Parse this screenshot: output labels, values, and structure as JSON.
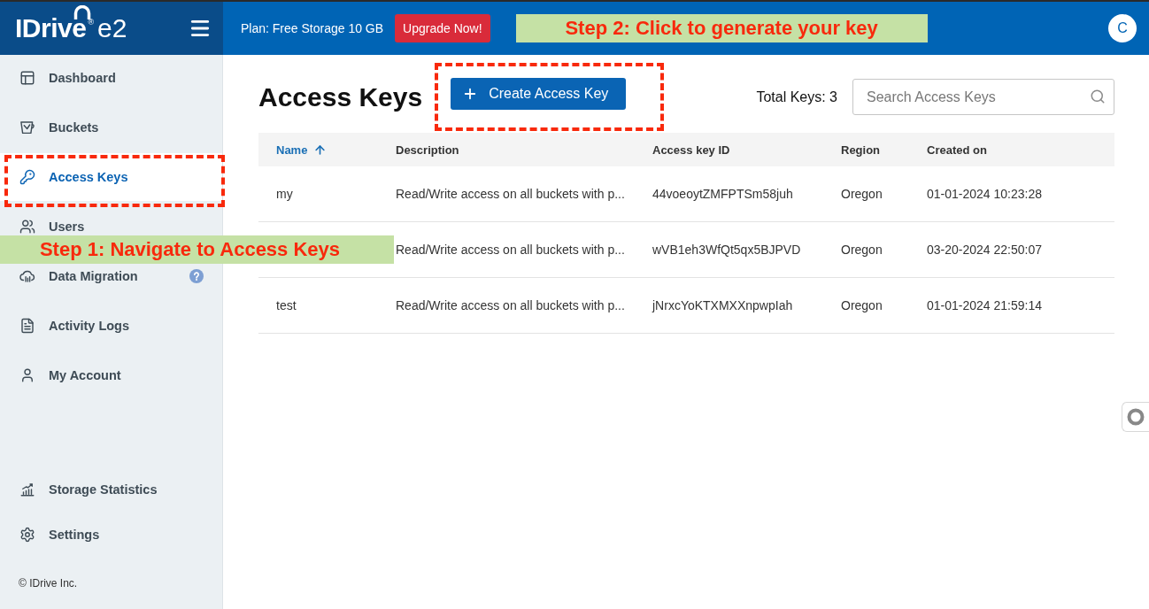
{
  "top_bar": {
    "logo": {
      "brand": "IDrive",
      "mark": "®",
      "product": "e2"
    },
    "plan": "Plan: Free Storage 10 GB",
    "upgrade_button": "Upgrade Now!",
    "callout": "Step 2: Click to generate your key",
    "avatar": "C"
  },
  "sidebar": {
    "items": [
      {
        "label": "Dashboard",
        "selected": false,
        "outlined": false,
        "help": false
      },
      {
        "label": "Buckets",
        "selected": false,
        "outlined": false,
        "help": false
      },
      {
        "label": "Access Keys",
        "selected": true,
        "outlined": true,
        "help": false
      },
      {
        "label": "Users",
        "selected": false,
        "outlined": false,
        "help": false
      },
      {
        "label": "Data Migration",
        "selected": false,
        "outlined": false,
        "help": true
      },
      {
        "label": "Activity Logs",
        "selected": false,
        "outlined": false,
        "help": false
      },
      {
        "label": "My Account",
        "selected": false,
        "outlined": false,
        "help": false
      }
    ],
    "bottom_items": [
      {
        "label": "Storage Statistics",
        "selected": false
      },
      {
        "label": "Settings",
        "selected": false
      }
    ],
    "footer": "© IDrive Inc.",
    "callout": "Step 1: Navigate to Access Keys"
  },
  "main": {
    "title": "Access Keys",
    "create_button": {
      "label": "Create Access Key",
      "outlined": true
    },
    "total": "Total Keys: 3",
    "search": {
      "placeholder": "Search Access Keys"
    },
    "table": {
      "columns": [
        {
          "label": "Name",
          "sorted": true
        },
        {
          "label": "Description",
          "sorted": false
        },
        {
          "label": "Access key ID",
          "sorted": false
        },
        {
          "label": "Region",
          "sorted": false
        },
        {
          "label": "Created on",
          "sorted": false
        }
      ],
      "rows": [
        {
          "name": "my",
          "description": "Read/Write access on all buckets with p...",
          "access_key_id": "44voeoytZMFPTSm58juh",
          "region": "Oregon",
          "created_on": "01-01-2024 10:23:28"
        },
        {
          "description": "Read/Write access on all buckets with p...",
          "access_key_id": "wVB1eh3WfQt5qx5BJPVD",
          "region": "Oregon",
          "created_on": "03-20-2024 22:50:07"
        },
        {
          "name": "test",
          "description": "Read/Write access on all buckets with p...",
          "access_key_id": "jNrxcYoKTXMXXnpwpIah",
          "region": "Oregon",
          "created_on": "01-01-2024 21:59:14"
        }
      ]
    }
  }
}
